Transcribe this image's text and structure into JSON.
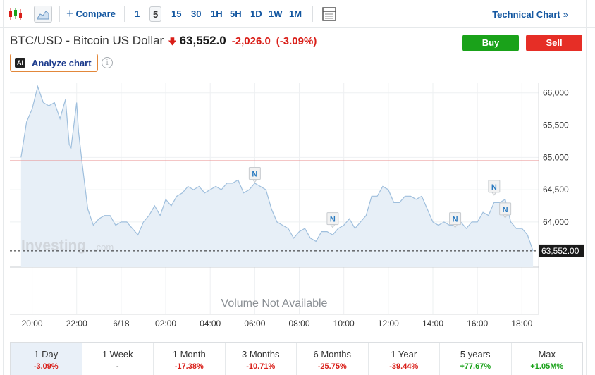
{
  "toolbar": {
    "candlestick_icon": "candlestick-icon",
    "area_icon": "area-chart-icon",
    "compare_label": "Compare",
    "intervals": [
      "1",
      "5",
      "15",
      "30",
      "1H",
      "5H",
      "1D",
      "1W",
      "1M"
    ],
    "active_interval": "5",
    "table_icon": "table-icon",
    "technical_link": "Technical Chart",
    "technical_chevron": "»"
  },
  "header": {
    "title": "BTC/USD - Bitcoin US Dollar",
    "direction_icon": "down-arrow-icon",
    "last_price": "63,552.0",
    "change": "-2,026.0",
    "change_pct": "(-3.09%)",
    "buy_label": "Buy",
    "sell_label": "Sell",
    "analyze_badge": "AI",
    "analyze_label": "Analyze chart",
    "info_glyph": "i"
  },
  "chart_data": {
    "type": "area",
    "series": [
      {
        "x": [
          "19:30",
          "19:45",
          "20:00",
          "20:15",
          "20:30",
          "20:45",
          "21:00",
          "21:15",
          "21:30",
          "21:40",
          "21:45",
          "22:00",
          "22:05",
          "22:15",
          "22:30",
          "22:45",
          "23:00",
          "23:15",
          "23:30",
          "23:45",
          "00:00",
          "00:15",
          "00:30",
          "00:45",
          "01:00",
          "01:15",
          "01:30",
          "01:45",
          "02:00",
          "02:15",
          "02:30",
          "02:45",
          "03:00",
          "03:15",
          "03:30",
          "03:45",
          "04:00",
          "04:15",
          "04:30",
          "04:45",
          "05:00",
          "05:15",
          "05:30",
          "05:45",
          "06:00",
          "06:15",
          "06:30",
          "06:45",
          "07:00",
          "07:15",
          "07:30",
          "07:45",
          "08:00",
          "08:15",
          "08:30",
          "08:45",
          "09:00",
          "09:15",
          "09:30",
          "09:45",
          "10:00",
          "10:15",
          "10:30",
          "10:45",
          "11:00",
          "11:15",
          "11:30",
          "11:45",
          "12:00",
          "12:15",
          "12:30",
          "12:45",
          "13:00",
          "13:15",
          "13:30",
          "13:45",
          "14:00",
          "14:15",
          "14:30",
          "14:45",
          "15:00",
          "15:15",
          "15:30",
          "15:45",
          "16:00",
          "16:15",
          "16:30",
          "16:45",
          "17:00",
          "17:15",
          "17:30",
          "17:45",
          "18:00",
          "18:15",
          "18:30"
        ],
        "y": [
          65000,
          65550,
          65750,
          66100,
          65850,
          65800,
          65850,
          65600,
          65900,
          65200,
          65150,
          65850,
          65400,
          64900,
          64200,
          63950,
          64050,
          64100,
          64100,
          63950,
          64000,
          64000,
          63900,
          63800,
          64000,
          64100,
          64250,
          64100,
          64350,
          64250,
          64400,
          64450,
          64550,
          64500,
          64550,
          64450,
          64500,
          64550,
          64500,
          64600,
          64600,
          64650,
          64450,
          64500,
          64600,
          64550,
          64500,
          64200,
          64000,
          63950,
          63900,
          63750,
          63850,
          63900,
          63750,
          63700,
          63850,
          63850,
          63800,
          63900,
          63950,
          64050,
          63900,
          64000,
          64100,
          64400,
          64400,
          64550,
          64500,
          64300,
          64300,
          64400,
          64400,
          64350,
          64400,
          64200,
          64000,
          63950,
          64000,
          63950,
          63950,
          64000,
          63900,
          64000,
          64000,
          64150,
          64100,
          64300,
          64300,
          64350,
          64000,
          63900,
          63900,
          63800,
          63550
        ]
      }
    ],
    "ylim": [
      63300,
      66150
    ],
    "yticks": [
      "66,000",
      "65,500",
      "65,000",
      "64,500",
      "64,000"
    ],
    "ytick_values": [
      66000,
      65500,
      65000,
      64500,
      64000
    ],
    "xticks": [
      "20:00",
      "22:00",
      "6/18",
      "02:00",
      "04:00",
      "06:00",
      "08:00",
      "10:00",
      "12:00",
      "14:00",
      "16:00",
      "18:00"
    ],
    "reference_value": 64950,
    "last_value": 63552,
    "last_label": "63,552.00",
    "news_marker_label": "N",
    "news_times": [
      "06:00",
      "09:30",
      "15:00",
      "16:45",
      "17:15"
    ],
    "news_values": [
      64550,
      63850,
      63850,
      64350,
      64000
    ],
    "volume_note": "Volume Not Available",
    "watermark": "Investing",
    "watermark_suffix": ".com",
    "line_color": "#9fbfdd",
    "area_color": "#e7eff7",
    "reference_color": "#e88c8c"
  },
  "periods": [
    {
      "label": "1 Day",
      "value": "-3.09%",
      "tone": "neg"
    },
    {
      "label": "1 Week",
      "value": "-",
      "tone": "neu"
    },
    {
      "label": "1 Month",
      "value": "-17.38%",
      "tone": "neg"
    },
    {
      "label": "3 Months",
      "value": "-10.71%",
      "tone": "neg"
    },
    {
      "label": "6 Months",
      "value": "-25.75%",
      "tone": "neg"
    },
    {
      "label": "1 Year",
      "value": "-39.44%",
      "tone": "neg"
    },
    {
      "label": "5 years",
      "value": "+77.67%",
      "tone": "pos"
    },
    {
      "label": "Max",
      "value": "+1.05M%",
      "tone": "pos"
    }
  ]
}
